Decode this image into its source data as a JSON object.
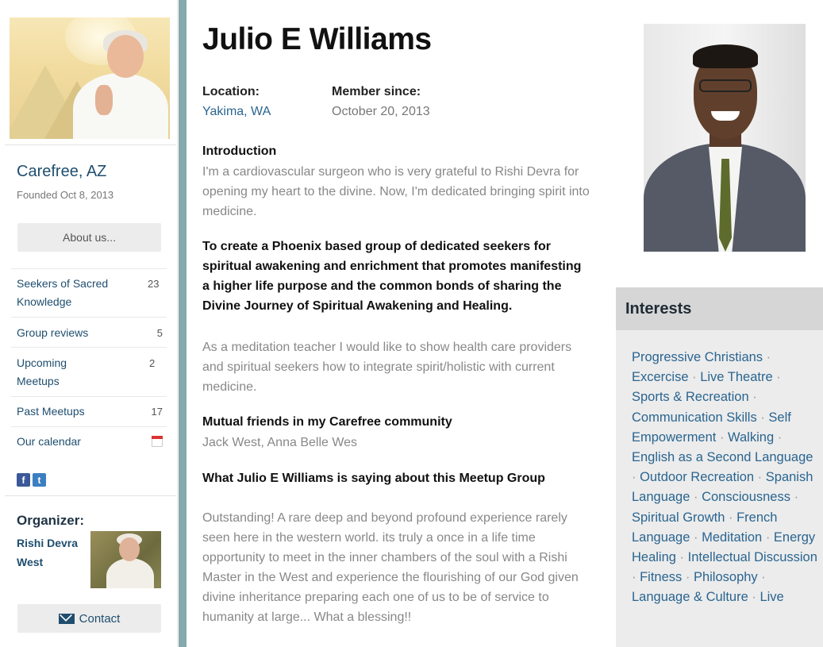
{
  "sidebar": {
    "group_name": "Carefree, AZ",
    "founded": "Founded Oct 8, 2013",
    "about_label": "About us...",
    "links": [
      {
        "label": "Seekers of Sacred Knowledge",
        "count": "23"
      },
      {
        "label": "Group reviews",
        "count": "5"
      },
      {
        "label": "Upcoming Meetups",
        "count": "2"
      },
      {
        "label": "Past Meetups",
        "count": "17"
      },
      {
        "label": "Our calendar",
        "count": ""
      }
    ],
    "social_icons": [
      "facebook-icon",
      "twitter-icon"
    ],
    "organizer_label": "Organizer:",
    "organizer_name": "Rishi Devra West",
    "contact_label": "Contact"
  },
  "profile": {
    "name": "Julio E Williams",
    "location_label": "Location:",
    "location_value": "Yakima, WA",
    "member_label": "Member since:",
    "member_value": "October 20, 2013",
    "intro_heading": "Introduction",
    "intro_text": "I'm a cardiovascular surgeon who is very grateful to Rishi Devra for opening my heart to the divine. Now, I'm dedicated bringing spirit into medicine.",
    "purpose_heading": "To create a Phoenix based group of dedicated seekers for spiritual awakening and enrichment that promotes manifesting a higher life purpose and the common bonds of sharing the Divine Journey of Spiritual Awakening and Healing.",
    "purpose_text": "As a meditation teacher I would like to show health care providers and spiritual seekers how to integrate spirit/holistic with current medicine.",
    "friends_heading": "Mutual friends in my Carefree community",
    "friends_text": "Jack West, Anna Belle Wes",
    "saying_heading": "What Julio E Williams is saying about this Meetup Group",
    "saying_text": "Outstanding! A rare deep and beyond profound experience rarely seen here in the western world. its truly a once in a life time opportunity to meet in the inner chambers of the soul with a Rishi Master in the West and experience the flourishing of our God given divine inheritance preparing each one of us to be of service to humanity at large... What a blessing!!"
  },
  "interests": {
    "title": "Interests",
    "items": [
      "Progressive Christians",
      "Excercise",
      "Live Theatre",
      "Sports & Recreation",
      "Communication Skills",
      "Self Empowerment",
      "Walking",
      "English as a Second Language",
      "Outdoor Recreation",
      "Spanish Language",
      "Consciousness",
      "Spiritual Growth",
      "French Language",
      "Meditation",
      "Energy Healing",
      "Intellectual Discussion",
      "Fitness",
      "Philosophy",
      "Language & Culture",
      "Live"
    ]
  },
  "colors": {
    "link_blue": "#2a6590",
    "accent_teal": "#86a9ad",
    "panel_grey": "#ececec"
  }
}
